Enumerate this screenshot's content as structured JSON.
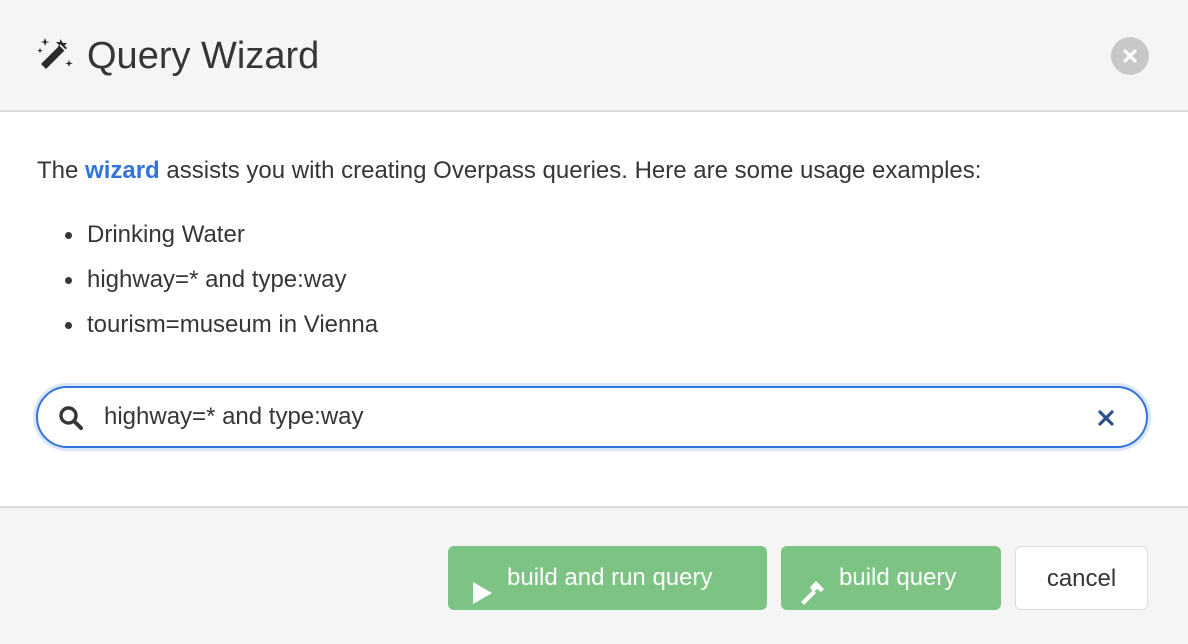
{
  "dialog": {
    "title": "Query Wizard",
    "icon": "magic-wand-icon",
    "close_icon": "close-circle-icon"
  },
  "body": {
    "intro_before": "The ",
    "intro_link": "wizard",
    "intro_after": " assists you with creating Overpass queries. Here are some usage examples:",
    "examples": [
      "Drinking Water",
      "highway=* and type:way",
      "tourism=museum in Vienna"
    ]
  },
  "search": {
    "value": "highway=* and type:way",
    "icon": "search-icon",
    "clear_icon": "clear-icon"
  },
  "footer": {
    "run_label": "build and run query",
    "run_icon": "play-icon",
    "build_label": "build query",
    "build_icon": "hammer-icon",
    "cancel_label": "cancel"
  },
  "colors": {
    "link": "#3273dc",
    "button_green": "#7dc383",
    "focus_border": "#3273dc",
    "header_bg": "#f5f5f5"
  }
}
